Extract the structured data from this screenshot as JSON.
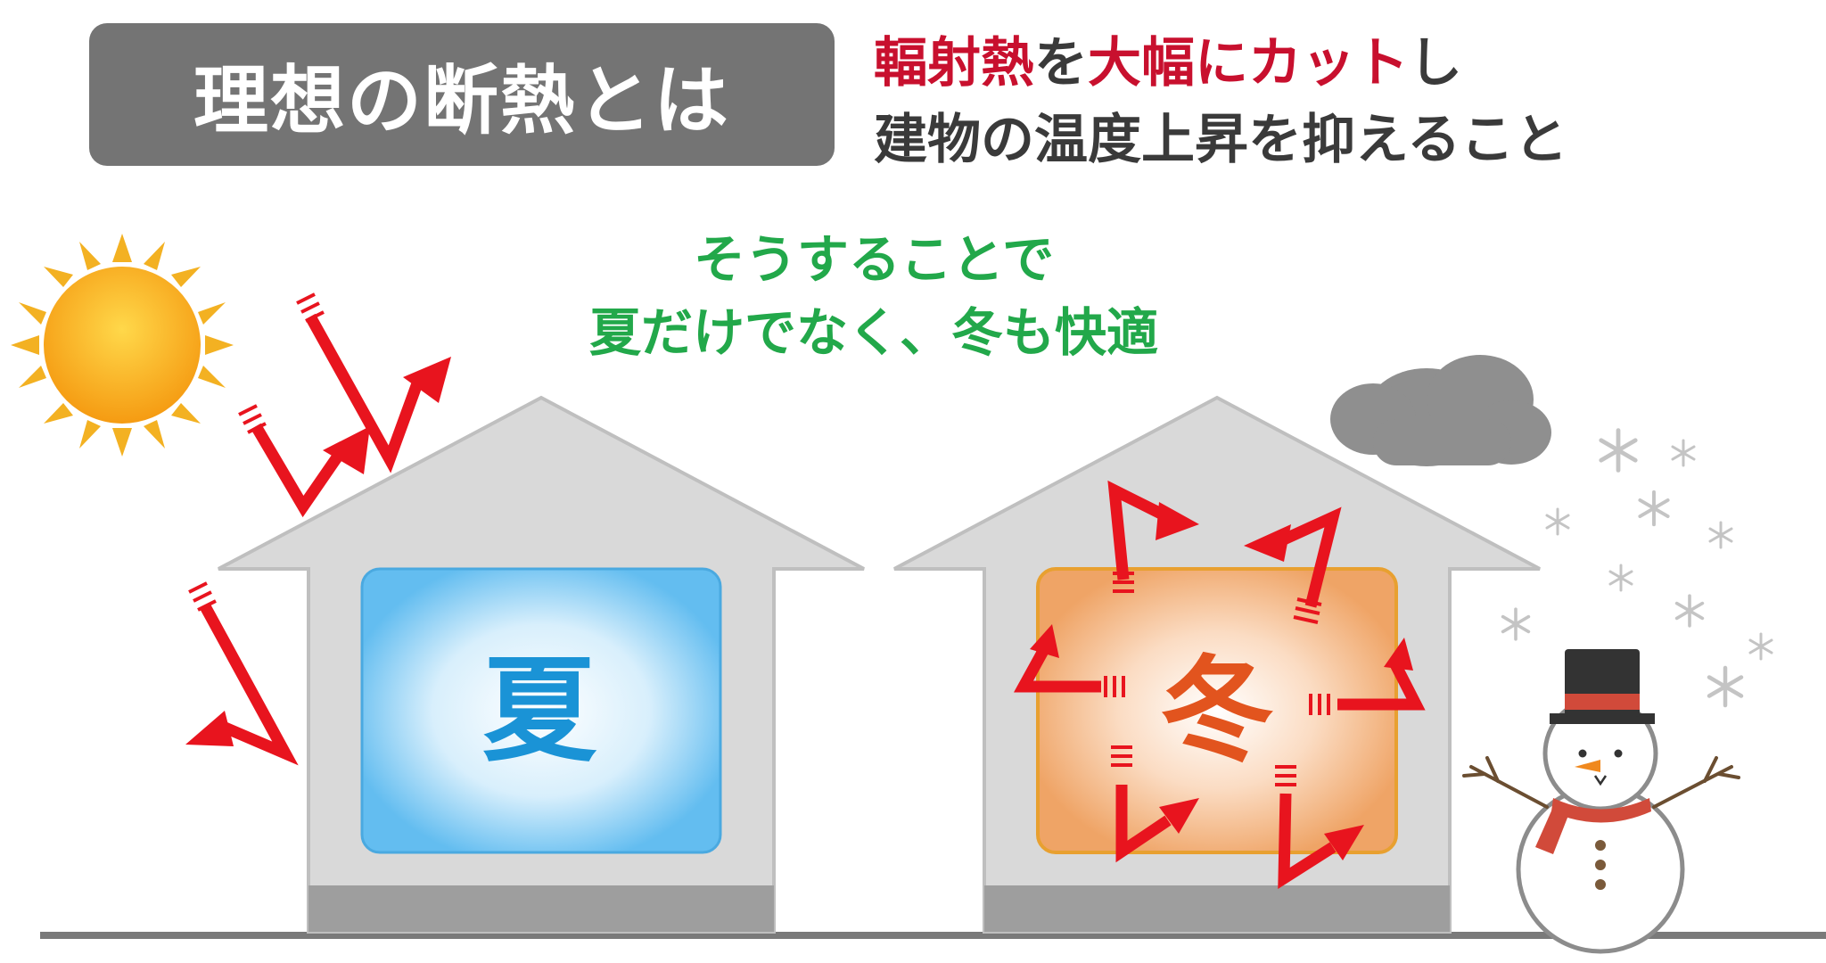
{
  "title": "理想の断熱とは",
  "headline": {
    "line1": [
      {
        "text": "輻射熱",
        "highlight": true
      },
      {
        "text": "を",
        "highlight": false
      },
      {
        "text": "大幅にカット",
        "highlight": true
      },
      {
        "text": "し",
        "highlight": false
      }
    ],
    "line2": "建物の温度上昇を抑えること"
  },
  "message": {
    "line1": "そうすることで",
    "line2": "夏だけでなく、冬も快適"
  },
  "houses": {
    "summer": {
      "label": "夏",
      "icon": "sun-icon"
    },
    "winter": {
      "label": "冬",
      "icon": "snowman-icon"
    }
  },
  "colors": {
    "title_bg": "#747474",
    "highlight": "#c8102e",
    "message": "#22a84a",
    "arrow": "#e8141e",
    "summer_window": "#63bdf0",
    "winter_window": "#efa466",
    "house": "#d9d9d9"
  }
}
